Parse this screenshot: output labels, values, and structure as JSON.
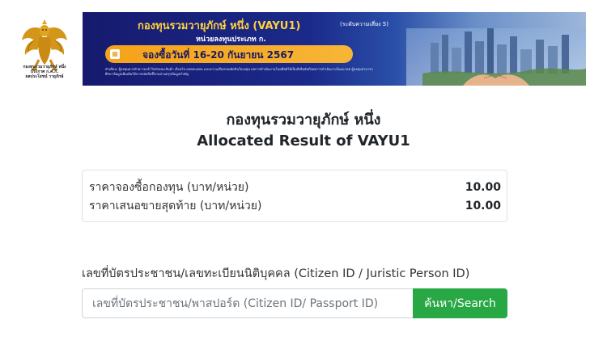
{
  "logo": {
    "caption_line1": "กองทุนรวมวายุภักษ์ หนึ่ง",
    "caption_line2": "ประกาศ ก.ค.ก.",
    "caption_line3": "ผลประโยชน์ วายุภักษ์"
  },
  "banner": {
    "title": "กองทุนรวมวายุภักษ์ หนึ่ง (VAYU1)",
    "risk": "(ระดับความเสี่ยง 5)",
    "subtitle": "หน่วยลงทุนประเภท ก.",
    "booking": "จองซื้อวันที่ 16-20 กันยายน 2567",
    "fine_print": "คำเตือน: ผู้ลงทุนควรทำความเข้าใจลักษณะสินค้า เงื่อนไข ผลตอบแทน และความเสี่ยงก่อนตัดสินใจลงทุน ผลการดำเนินงานในอดีตมิได้เป็นสิ่งยืนยันถึงผลการดำเนินงานในอนาคต ผู้ลงทุนสามารถศึกษาข้อมูลเพิ่มเติมได้จากหนังสือชี้ชวนส่วนสรุปข้อมูลสำคัญ"
  },
  "page": {
    "title_th": "กองทุนรวมวายุภักษ์ หนึ่ง",
    "title_en": "Allocated Result of VAYU1"
  },
  "prices": [
    {
      "label": "ราคาจองซื้อกองทุน (บาท/หน่วย)",
      "value": "10.00"
    },
    {
      "label": "ราคาเสนอขายสุดท้าย (บาท/หน่วย)",
      "value": "10.00"
    }
  ],
  "search": {
    "label": "เลขที่บัตรประชาชน/เลขทะเบียนนิติบุคคล (Citizen ID / Juristic Person ID)",
    "placeholder": "เลขที่บัตรประชาชน/พาสปอร์ต (Citizen ID/ Passport ID)",
    "value": "",
    "button": "ค้นหา/Search"
  },
  "colors": {
    "accent_button": "#28a745",
    "banner_gold": "#ffd23d",
    "banner_navy": "#161a6e"
  },
  "icons": {
    "logo": "garuda-emblem-icon",
    "calendar": "calendar-icon",
    "banner_art": "city-hands-illustration-icon"
  }
}
